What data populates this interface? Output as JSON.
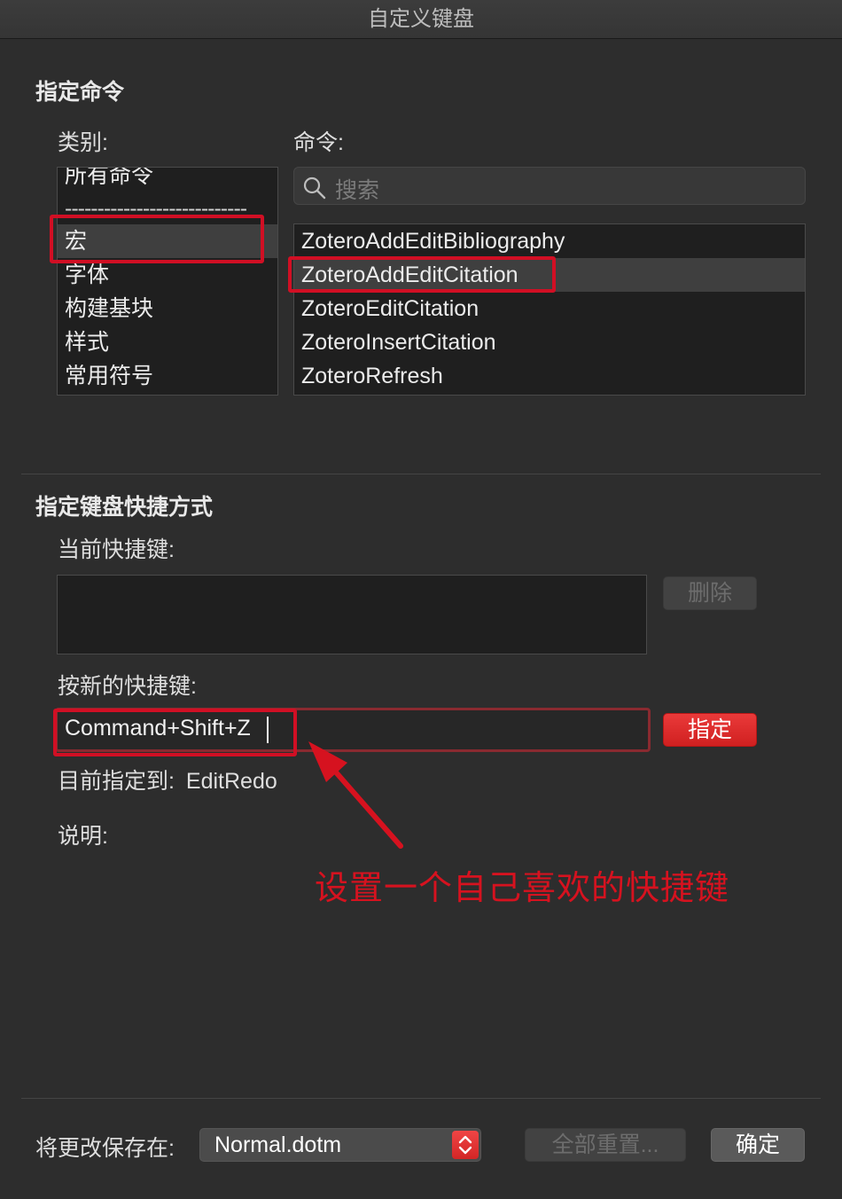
{
  "window": {
    "title": "自定义键盘"
  },
  "commands_section": {
    "title": "指定命令",
    "category_label": "类别:",
    "command_label": "命令:",
    "categories": [
      {
        "label": "所有命令"
      },
      {
        "label": "----------------------------"
      },
      {
        "label": "宏"
      },
      {
        "label": "字体"
      },
      {
        "label": "构建基块"
      },
      {
        "label": "样式"
      },
      {
        "label": "常用符号"
      }
    ],
    "selected_category": "宏",
    "search": {
      "placeholder": "搜索"
    },
    "commands": [
      {
        "label": "ZoteroAddEditBibliography"
      },
      {
        "label": "ZoteroAddEditCitation"
      },
      {
        "label": "ZoteroEditCitation"
      },
      {
        "label": "ZoteroInsertCitation"
      },
      {
        "label": "ZoteroRefresh"
      }
    ],
    "selected_command": "ZoteroAddEditCitation"
  },
  "shortcut_section": {
    "title": "指定键盘快捷方式",
    "current_label": "当前快捷键:",
    "current_value": "",
    "remove_button": "删除",
    "new_label": "按新的快捷键:",
    "new_value": "Command+Shift+Z",
    "assign_button": "指定",
    "assigned_to_label": "目前指定到:",
    "assigned_to_value": "EditRedo",
    "description_label": "说明:"
  },
  "annotation": {
    "text": "设置一个自己喜欢的快捷键",
    "color": "#d6121f"
  },
  "footer": {
    "save_in_label": "将更改保存在:",
    "save_in_value": "Normal.dotm",
    "reset_all_button": "全部重置...",
    "ok_button": "确定"
  },
  "colors": {
    "accent": "#d6121f",
    "background": "#2d2d2d"
  }
}
